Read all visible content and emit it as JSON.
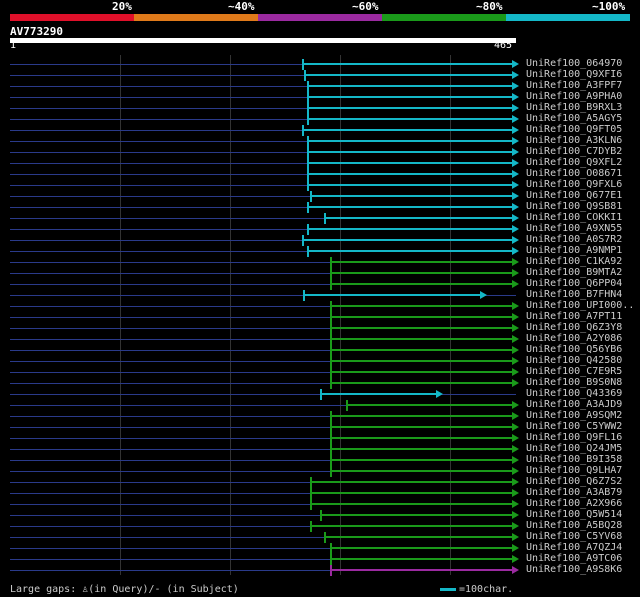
{
  "header": {
    "percent_labels": [
      "20%",
      "~40%",
      "~60%",
      "~80%",
      "~100%"
    ],
    "bar_colors": [
      "#e0102a",
      "#e07a1a",
      "#9b2aa0",
      "#1a9a1a",
      "#14b8c8"
    ],
    "query_id": "AV773290",
    "ruler_start": "1",
    "ruler_end": "465"
  },
  "hits": [
    {
      "label": "UniRef100_064970",
      "color": "#14b8c8"
    },
    {
      "label": "UniRef100_Q9XFI6",
      "color": "#14b8c8"
    },
    {
      "label": "UniRef100_A3FPF7",
      "color": "#14b8c8"
    },
    {
      "label": "UniRef100_A9PHA0",
      "color": "#14b8c8"
    },
    {
      "label": "UniRef100_B9RXL3",
      "color": "#14b8c8"
    },
    {
      "label": "UniRef100_A5AGY5",
      "color": "#14b8c8"
    },
    {
      "label": "UniRef100_Q9FT05",
      "color": "#14b8c8"
    },
    {
      "label": "UniRef100_A3KLN6",
      "color": "#14b8c8"
    },
    {
      "label": "UniRef100_C7DYB2",
      "color": "#14b8c8"
    },
    {
      "label": "UniRef100_Q9XFL2",
      "color": "#14b8c8"
    },
    {
      "label": "UniRef100_O08671",
      "color": "#14b8c8"
    },
    {
      "label": "UniRef100_Q9FXL6",
      "color": "#14b8c8"
    },
    {
      "label": "UniRef100_Q677E1",
      "color": "#14b8c8"
    },
    {
      "label": "UniRef100_Q9SB81",
      "color": "#14b8c8"
    },
    {
      "label": "UniRef100_COKKI1",
      "color": "#14b8c8"
    },
    {
      "label": "UniRef100_A9XN55",
      "color": "#14b8c8"
    },
    {
      "label": "UniRef100_A0S7R2",
      "color": "#14b8c8"
    },
    {
      "label": "UniRef100_A9NMP1",
      "color": "#14b8c8"
    },
    {
      "label": "UniRef100_C1KA92",
      "color": "#1a9a1a"
    },
    {
      "label": "UniRef100_B9MTA2",
      "color": "#1a9a1a"
    },
    {
      "label": "UniRef100_Q6PP04",
      "color": "#1a9a1a"
    },
    {
      "label": "UniRef100_B7FHN4",
      "color": "#14b8c8"
    },
    {
      "label": "UniRef100_UPI000..",
      "color": "#1a9a1a"
    },
    {
      "label": "UniRef100_A7PT11",
      "color": "#1a9a1a"
    },
    {
      "label": "UniRef100_Q6Z3Y8",
      "color": "#1a9a1a"
    },
    {
      "label": "UniRef100_A2Y086",
      "color": "#1a9a1a"
    },
    {
      "label": "UniRef100_Q56YB6",
      "color": "#1a9a1a"
    },
    {
      "label": "UniRef100_Q42580",
      "color": "#1a9a1a"
    },
    {
      "label": "UniRef100_C7E9R5",
      "color": "#1a9a1a"
    },
    {
      "label": "UniRef100_B9S0N8",
      "color": "#1a9a1a"
    },
    {
      "label": "UniRef100_Q43369",
      "color": "#14b8c8"
    },
    {
      "label": "UniRef100_A3AJD9",
      "color": "#1a9a1a"
    },
    {
      "label": "UniRef100_A9SQM2",
      "color": "#1a9a1a"
    },
    {
      "label": "UniRef100_C5YWW2",
      "color": "#1a9a1a"
    },
    {
      "label": "UniRef100_Q9FL16",
      "color": "#1a9a1a"
    },
    {
      "label": "UniRef100_Q24JM5",
      "color": "#1a9a1a"
    },
    {
      "label": "UniRef100_B9I358",
      "color": "#1a9a1a"
    },
    {
      "label": "UniRef100_Q9LHA7",
      "color": "#1a9a1a"
    },
    {
      "label": "UniRef100_Q6Z7S2",
      "color": "#1a9a1a"
    },
    {
      "label": "UniRef100_A3AB79",
      "color": "#1a9a1a"
    },
    {
      "label": "UniRef100_A2X966",
      "color": "#1a9a1a"
    },
    {
      "label": "UniRef100_Q5W514",
      "color": "#1a9a1a"
    },
    {
      "label": "UniRef100_A5BQ28",
      "color": "#1a9a1a"
    },
    {
      "label": "UniRef100_C5YV68",
      "color": "#1a9a1a"
    },
    {
      "label": "UniRef100_A7QZJ4",
      "color": "#1a9a1a"
    },
    {
      "label": "UniRef100_A9TC06",
      "color": "#1a9a1a"
    },
    {
      "label": "UniRef100_A9S8K6",
      "color": "#9b2aa0"
    }
  ],
  "footer": {
    "large_gaps_text": "Large gaps: ♙(in Query)/- (in Subject)",
    "legend_text": "=100char."
  }
}
